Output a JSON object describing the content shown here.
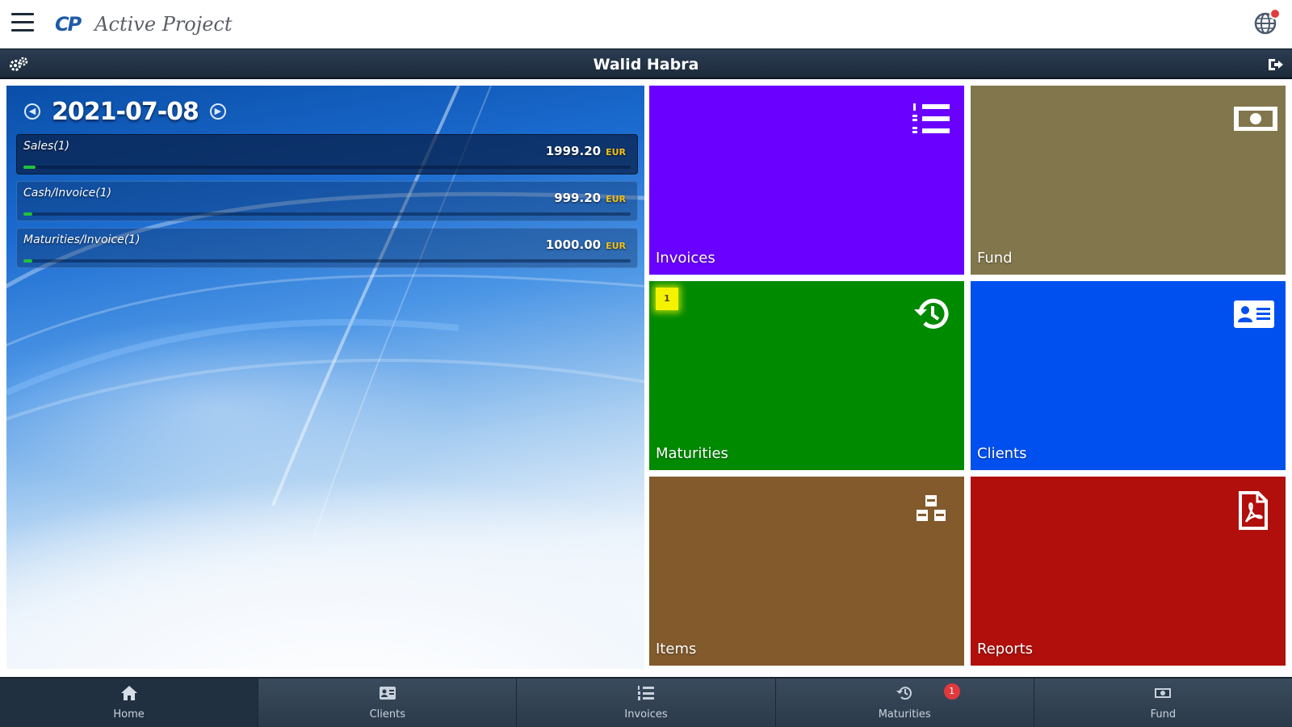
{
  "app": {
    "logo_mark": "CP",
    "logo_text": "Active Project"
  },
  "header": {
    "user_name": "Walid Habra"
  },
  "dashboard": {
    "date": "2021-07-08",
    "stats": [
      {
        "label": "Sales(1)",
        "amount": "1999.20",
        "currency": "EUR",
        "progress": 0.02
      },
      {
        "label": "Cash/Invoice(1)",
        "amount": "999.20",
        "currency": "EUR",
        "progress": 0.01
      },
      {
        "label": "Maturities/Invoice(1)",
        "amount": "1000.00",
        "currency": "EUR",
        "progress": 0.01
      }
    ]
  },
  "tiles": [
    {
      "id": "invoices",
      "label": "Invoices",
      "color": "#6a00ff",
      "icon": "numbered-list-icon"
    },
    {
      "id": "fund",
      "label": "Fund",
      "color": "#82764c",
      "icon": "money-bill-icon"
    },
    {
      "id": "maturities",
      "label": "Maturities",
      "color": "#008a00",
      "icon": "history-icon",
      "badge": "1"
    },
    {
      "id": "clients",
      "label": "Clients",
      "color": "#0050f0",
      "icon": "contact-card-icon"
    },
    {
      "id": "items",
      "label": "Items",
      "color": "#825a2c",
      "icon": "cubes-icon"
    },
    {
      "id": "reports",
      "label": "Reports",
      "color": "#b10f0c",
      "icon": "pdf-file-icon"
    }
  ],
  "bottom_nav": [
    {
      "label": "Home",
      "icon": "home-icon",
      "active": true
    },
    {
      "label": "Clients",
      "icon": "contact-card-icon"
    },
    {
      "label": "Invoices",
      "icon": "numbered-list-icon"
    },
    {
      "label": "Maturities",
      "icon": "history-icon",
      "badge": "1"
    },
    {
      "label": "Fund",
      "icon": "money-bill-icon"
    }
  ]
}
